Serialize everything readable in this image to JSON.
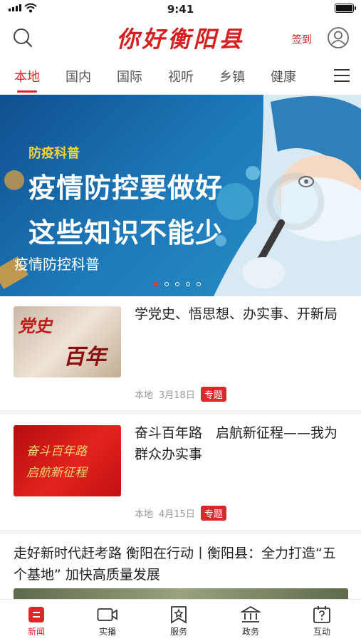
{
  "status": {
    "time": "9:41"
  },
  "header": {
    "brand": "你好衡阳县",
    "signin": "签到"
  },
  "tabs": [
    "本地",
    "国内",
    "国际",
    "视听",
    "乡镇",
    "健康"
  ],
  "banner": {
    "tag": "防疫科普",
    "headline_1": "疫情防控要做好",
    "headline_2": "这些知识不能少",
    "caption": "疫情防控科普"
  },
  "news": [
    {
      "title": "学党史、悟思想、办实事、开新局",
      "thumb_text_1": "党史",
      "thumb_text_2": "百年",
      "source": "本地",
      "date": "3月18日",
      "badge": "专题"
    },
    {
      "title": "奋斗百年路　启航新征程——我为群众办实事",
      "thumb_text_1": "奋斗百年路",
      "thumb_text_2": "启航新征程",
      "source": "本地",
      "date": "4月15日",
      "badge": "专题"
    }
  ],
  "wide_news": {
    "title": "走好新时代赶考路 衡阳在行动丨衡阳县：全力打造“五个基地” 加快高质量发展"
  },
  "tabbar": [
    {
      "label": "新闻",
      "icon": "news-icon"
    },
    {
      "label": "实播",
      "icon": "video-camera-icon"
    },
    {
      "label": "服务",
      "icon": "service-icon"
    },
    {
      "label": "政务",
      "icon": "government-icon"
    },
    {
      "label": "互动",
      "icon": "interaction-icon"
    }
  ],
  "colors": {
    "accent": "#e0262c",
    "brand": "#d81e1e"
  }
}
